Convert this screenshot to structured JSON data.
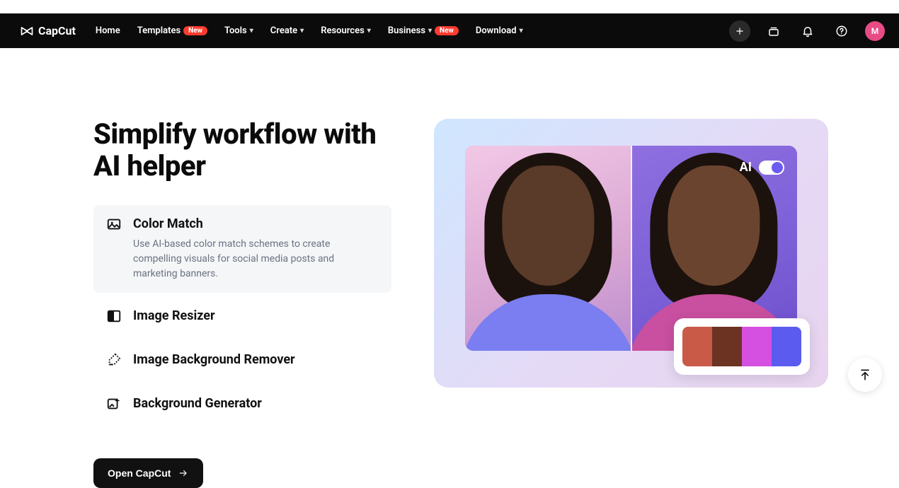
{
  "brand": {
    "name": "CapCut"
  },
  "nav": {
    "items": [
      {
        "label": "Home",
        "dropdown": false,
        "badge": null
      },
      {
        "label": "Templates",
        "dropdown": false,
        "badge": "New"
      },
      {
        "label": "Tools",
        "dropdown": true,
        "badge": null
      },
      {
        "label": "Create",
        "dropdown": true,
        "badge": null
      },
      {
        "label": "Resources",
        "dropdown": true,
        "badge": null
      },
      {
        "label": "Business",
        "dropdown": true,
        "badge": "New"
      },
      {
        "label": "Download",
        "dropdown": true,
        "badge": null
      }
    ]
  },
  "user": {
    "avatar_initial": "M"
  },
  "hero": {
    "title": "Simplify workflow with AI helper",
    "cta_label": "Open CapCut"
  },
  "features": [
    {
      "id": "color-match",
      "title": "Color Match",
      "desc": "Use AI-based color match schemes to create compelling visuals for social media posts and marketing banners.",
      "active": true
    },
    {
      "id": "image-resizer",
      "title": "Image Resizer",
      "desc": "",
      "active": false
    },
    {
      "id": "bg-remover",
      "title": "Image Background Remover",
      "desc": "",
      "active": false
    },
    {
      "id": "bg-generator",
      "title": "Background Generator",
      "desc": "",
      "active": false
    }
  ],
  "preview": {
    "toggle_label": "AI",
    "toggle_on": true,
    "palette": [
      "#c95a48",
      "#6c3322",
      "#d54fe0",
      "#5b5bf0"
    ]
  }
}
